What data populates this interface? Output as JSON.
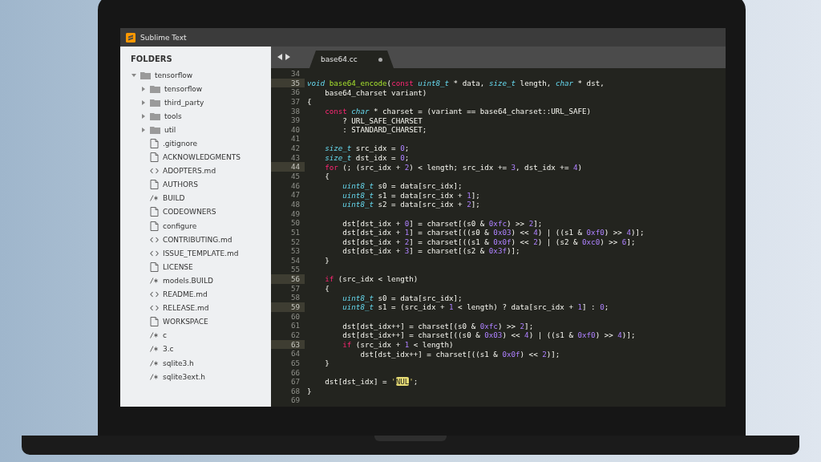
{
  "window": {
    "title": "Sublime Text"
  },
  "sidebar": {
    "heading": "FOLDERS",
    "tree": [
      {
        "name": "tensorflow",
        "kind": "folder",
        "expanded": true,
        "children": [
          {
            "name": "tensorflow",
            "kind": "folder",
            "expanded": false
          },
          {
            "name": "third_party",
            "kind": "folder",
            "expanded": false
          },
          {
            "name": "tools",
            "kind": "folder",
            "expanded": false
          },
          {
            "name": "util",
            "kind": "folder",
            "expanded": false
          },
          {
            "name": ".gitignore",
            "kind": "file"
          },
          {
            "name": "ACKNOWLEDGMENTS",
            "kind": "file"
          },
          {
            "name": "ADOPTERS.md",
            "kind": "markup"
          },
          {
            "name": "AUTHORS",
            "kind": "file"
          },
          {
            "name": "BUILD",
            "kind": "code"
          },
          {
            "name": "CODEOWNERS",
            "kind": "file"
          },
          {
            "name": "configure",
            "kind": "file"
          },
          {
            "name": "CONTRIBUTING.md",
            "kind": "markup"
          },
          {
            "name": "ISSUE_TEMPLATE.md",
            "kind": "markup"
          },
          {
            "name": "LICENSE",
            "kind": "file"
          },
          {
            "name": "models.BUILD",
            "kind": "code"
          },
          {
            "name": "README.md",
            "kind": "markup"
          },
          {
            "name": "RELEASE.md",
            "kind": "markup"
          },
          {
            "name": "WORKSPACE",
            "kind": "file"
          },
          {
            "name": "c",
            "kind": "code"
          },
          {
            "name": "3.c",
            "kind": "code"
          },
          {
            "name": "sqlite3.h",
            "kind": "code"
          },
          {
            "name": "sqlite3ext.h",
            "kind": "code"
          }
        ]
      }
    ]
  },
  "tab": {
    "label": "base64.cc",
    "modified": true
  },
  "lines": [
    {
      "number": "34",
      "current": false
    },
    {
      "number": "35",
      "current": true,
      "tokens": [
        {
          "kind": "type",
          "text": "void "
        },
        {
          "kind": "fn",
          "text": "base64_encode"
        },
        "(",
        {
          "kind": "kw",
          "text": "const "
        },
        {
          "kind": "type",
          "text": "uint8_t"
        },
        " * data, ",
        {
          "kind": "type",
          "text": "size_t"
        },
        " length, ",
        {
          "kind": "type",
          "text": "char"
        },
        " * dst,"
      ]
    },
    {
      "number": "36",
      "current": false,
      "tokens": [
        "    base64_charset variant)"
      ]
    },
    {
      "number": "37",
      "current": false,
      "tokens": [
        "{"
      ]
    },
    {
      "number": "38",
      "current": false,
      "tokens": [
        {
          "kind": "kw",
          "text": "    const "
        },
        {
          "kind": "type",
          "text": "char"
        },
        " * charset = (variant == base64_charset::URL_SAFE)"
      ]
    },
    {
      "number": "39",
      "current": false,
      "tokens": [
        "        ? URL_SAFE_CHARSET"
      ]
    },
    {
      "number": "40",
      "current": false,
      "tokens": [
        "        : STANDARD_CHARSET;"
      ]
    },
    {
      "number": "41",
      "current": false
    },
    {
      "number": "42",
      "current": false,
      "tokens": [
        {
          "kind": "type",
          "text": "    size_t"
        },
        " src_idx = ",
        {
          "kind": "num",
          "text": "0"
        },
        ";"
      ]
    },
    {
      "number": "43",
      "current": false,
      "tokens": [
        {
          "kind": "type",
          "text": "    size_t"
        },
        " dst_idx = ",
        {
          "kind": "num",
          "text": "0"
        },
        ";"
      ]
    },
    {
      "number": "44",
      "current": true,
      "tokens": [
        {
          "kind": "kw",
          "text": "    for"
        },
        " (; (src_idx + ",
        {
          "kind": "num",
          "text": "2"
        },
        ") < length; src_idx += ",
        {
          "kind": "num",
          "text": "3"
        },
        ", dst_idx += ",
        {
          "kind": "num",
          "text": "4"
        },
        ")"
      ]
    },
    {
      "number": "45",
      "current": false,
      "tokens": [
        "    {"
      ]
    },
    {
      "number": "46",
      "current": false,
      "tokens": [
        {
          "kind": "type",
          "text": "        uint8_t"
        },
        " s0 = data[src_idx];"
      ]
    },
    {
      "number": "47",
      "current": false,
      "tokens": [
        {
          "kind": "type",
          "text": "        uint8_t"
        },
        " s1 = data[src_idx + ",
        {
          "kind": "num",
          "text": "1"
        },
        "];"
      ]
    },
    {
      "number": "48",
      "current": false,
      "tokens": [
        {
          "kind": "type",
          "text": "        uint8_t"
        },
        " s2 = data[src_idx + ",
        {
          "kind": "num",
          "text": "2"
        },
        "];"
      ]
    },
    {
      "number": "49",
      "current": false
    },
    {
      "number": "50",
      "current": false,
      "tokens": [
        "        dst[dst_idx + ",
        {
          "kind": "num",
          "text": "0"
        },
        "] = charset[(s0 & ",
        {
          "kind": "num",
          "text": "0xfc"
        },
        ") >> ",
        {
          "kind": "num",
          "text": "2"
        },
        "];"
      ]
    },
    {
      "number": "51",
      "current": false,
      "tokens": [
        "        dst[dst_idx + ",
        {
          "kind": "num",
          "text": "1"
        },
        "] = charset[((s0 & ",
        {
          "kind": "num",
          "text": "0x03"
        },
        ") << ",
        {
          "kind": "num",
          "text": "4"
        },
        ") | ((s1 & ",
        {
          "kind": "num",
          "text": "0xf0"
        },
        ") >> ",
        {
          "kind": "num",
          "text": "4"
        },
        ")];"
      ]
    },
    {
      "number": "52",
      "current": false,
      "tokens": [
        "        dst[dst_idx + ",
        {
          "kind": "num",
          "text": "2"
        },
        "] = charset[((s1 & ",
        {
          "kind": "num",
          "text": "0x0f"
        },
        ") << ",
        {
          "kind": "num",
          "text": "2"
        },
        ") | (s2 & ",
        {
          "kind": "num",
          "text": "0xc0"
        },
        ") >> ",
        {
          "kind": "num",
          "text": "6"
        },
        "];"
      ]
    },
    {
      "number": "53",
      "current": false,
      "tokens": [
        "        dst[dst_idx + ",
        {
          "kind": "num",
          "text": "3"
        },
        "] = charset[(s2 & ",
        {
          "kind": "num",
          "text": "0x3f"
        },
        ")];"
      ]
    },
    {
      "number": "54",
      "current": false,
      "tokens": [
        "    }"
      ]
    },
    {
      "number": "55",
      "current": false
    },
    {
      "number": "56",
      "current": true,
      "tokens": [
        {
          "kind": "kw",
          "text": "    if"
        },
        " (src_idx < length)"
      ]
    },
    {
      "number": "57",
      "current": false,
      "tokens": [
        "    {"
      ]
    },
    {
      "number": "58",
      "current": false,
      "tokens": [
        {
          "kind": "type",
          "text": "        uint8_t"
        },
        " s0 = data[src_idx];"
      ]
    },
    {
      "number": "59",
      "current": true,
      "tokens": [
        {
          "kind": "type",
          "text": "        uint8_t"
        },
        " s1 = (src_idx + ",
        {
          "kind": "num",
          "text": "1"
        },
        " < length) ? data[src_idx + ",
        {
          "kind": "num",
          "text": "1"
        },
        "] : ",
        {
          "kind": "num",
          "text": "0"
        },
        ";"
      ]
    },
    {
      "number": "60",
      "current": false
    },
    {
      "number": "61",
      "current": false,
      "tokens": [
        "        dst[dst_idx++] = charset[(s0 & ",
        {
          "kind": "num",
          "text": "0xfc"
        },
        ") >> ",
        {
          "kind": "num",
          "text": "2"
        },
        "];"
      ]
    },
    {
      "number": "62",
      "current": false,
      "tokens": [
        "        dst[dst_idx++] = charset[((s0 & ",
        {
          "kind": "num",
          "text": "0x03"
        },
        ") << ",
        {
          "kind": "num",
          "text": "4"
        },
        ") | ((s1 & ",
        {
          "kind": "num",
          "text": "0xf0"
        },
        ") >> ",
        {
          "kind": "num",
          "text": "4"
        },
        ")];"
      ]
    },
    {
      "number": "63",
      "current": true,
      "tokens": [
        {
          "kind": "kw",
          "text": "        if"
        },
        " (src_idx + ",
        {
          "kind": "num",
          "text": "1"
        },
        " < length)"
      ]
    },
    {
      "number": "64",
      "current": false,
      "tokens": [
        "            dst[dst_idx++] = charset[((s1 & ",
        {
          "kind": "num",
          "text": "0x0f"
        },
        ") << ",
        {
          "kind": "num",
          "text": "2"
        },
        ")];"
      ]
    },
    {
      "number": "65",
      "current": false,
      "tokens": [
        "    }"
      ]
    },
    {
      "number": "66",
      "current": false
    },
    {
      "number": "67",
      "current": false,
      "tokens": [
        "    dst[dst_idx] = ",
        {
          "kind": "str",
          "text": "'"
        },
        {
          "kind": "badge",
          "text": "NUL"
        },
        {
          "kind": "str",
          "text": "'"
        },
        ";"
      ]
    },
    {
      "number": "68",
      "current": false,
      "tokens": [
        "}"
      ]
    },
    {
      "number": "69",
      "current": false
    }
  ]
}
